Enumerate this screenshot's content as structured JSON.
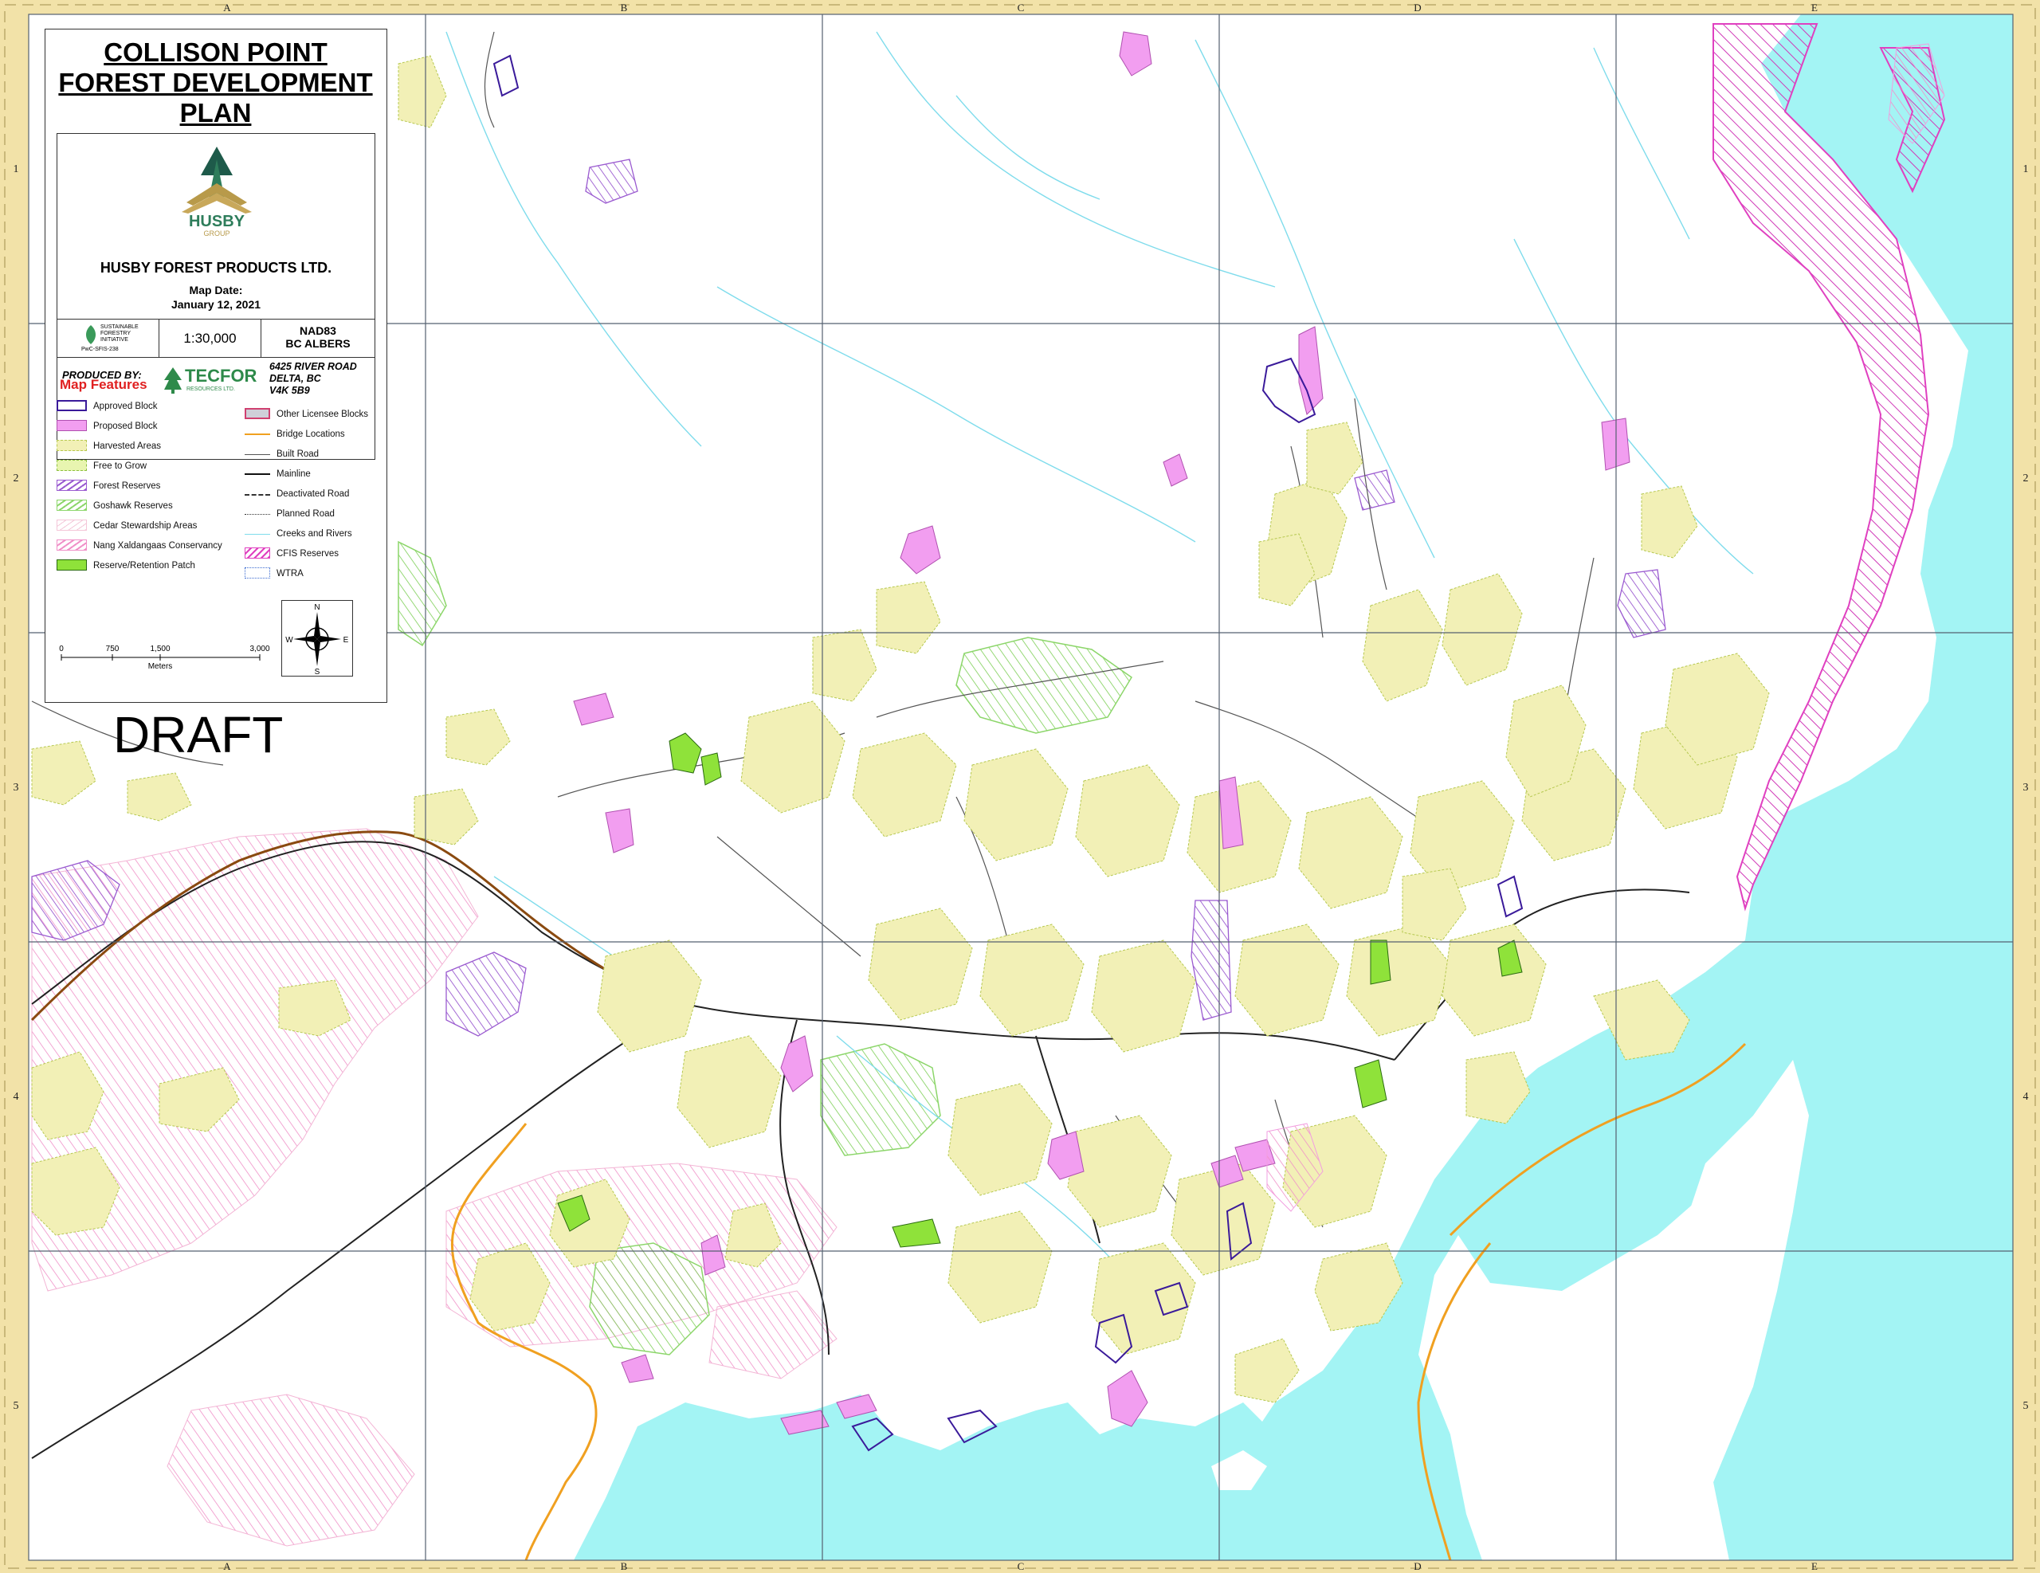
{
  "title": {
    "line1": "COLLISON POINT",
    "line2": "FOREST DEVELOPMENT",
    "line3": "PLAN"
  },
  "logo": {
    "text": "HUSBY",
    "subtext": "GROUP",
    "icon": "tree-logo-icon",
    "color": "#2e7d5b",
    "accent": "#b89a4a"
  },
  "company_name": "HUSBY FOREST PRODUCTS LTD.",
  "map_date_label": "Map Date:",
  "map_date": "January 12, 2021",
  "sfi": {
    "line1": "SUSTAINABLE",
    "line2": "FORESTRY",
    "line3": "INITIATIVE",
    "cert": "PwC-SFIS-238"
  },
  "scale": "1:30,000",
  "projection": {
    "line1": "NAD83",
    "line2": "BC ALBERS"
  },
  "produced_by": {
    "label": "PRODUCED BY:",
    "company": "TECFOR",
    "company_sub": "RESOURCES LTD.",
    "address1": "6425 RIVER ROAD",
    "address2": "DELTA, BC",
    "address3": "V4K 5B9"
  },
  "legend": {
    "title": "Map Features",
    "left": [
      {
        "label": "Approved Block",
        "style": "approved"
      },
      {
        "label": "Proposed Block",
        "style": "proposed"
      },
      {
        "label": "Harvested Areas",
        "style": "harvested"
      },
      {
        "label": "Free to Grow",
        "style": "ftg"
      },
      {
        "label": "Forest Reserves",
        "style": "forest-reserve"
      },
      {
        "label": "Goshawk Reserves",
        "style": "goshawk"
      },
      {
        "label": "Cedar Stewardship Areas",
        "style": "cedar"
      },
      {
        "label": "Nang Xaldangaas Conservancy",
        "style": "nang"
      },
      {
        "label": "Reserve/Retention Patch",
        "style": "retention"
      }
    ],
    "right": [
      {
        "label": "Other Licensee Blocks",
        "style": "other"
      },
      {
        "label": "Bridge Locations",
        "style": "bridge"
      },
      {
        "label": "Built Road",
        "style": "built"
      },
      {
        "label": "Mainline",
        "style": "mainline"
      },
      {
        "label": "Deactivated Road",
        "style": "deact"
      },
      {
        "label": "Planned Road",
        "style": "planned"
      },
      {
        "label": "Creeks and Rivers",
        "style": "creeks"
      },
      {
        "label": "CFIS Reserves",
        "style": "cfis"
      },
      {
        "label": "WTRA",
        "style": "wtra"
      }
    ]
  },
  "north_arrow": {
    "n": "N",
    "s": "S",
    "e": "E",
    "w": "W"
  },
  "scale_bar": {
    "ticks": [
      "0",
      "750",
      "1,500",
      "3,000"
    ],
    "unit": "Meters"
  },
  "draft": "DRAFT",
  "grid": {
    "columns": [
      "A",
      "B",
      "C",
      "D",
      "E"
    ],
    "rows": [
      "1",
      "2",
      "3",
      "4",
      "5"
    ]
  },
  "colors": {
    "water": "#a3f4f4",
    "harvested": "#f2f0b6",
    "proposed": "#f29ef0",
    "approved": "#3a1a9a",
    "cfis": "#e040c0",
    "goshawk": "#8cd66a",
    "cedar": "#f4a6c8",
    "border": "#f2e2a8"
  }
}
